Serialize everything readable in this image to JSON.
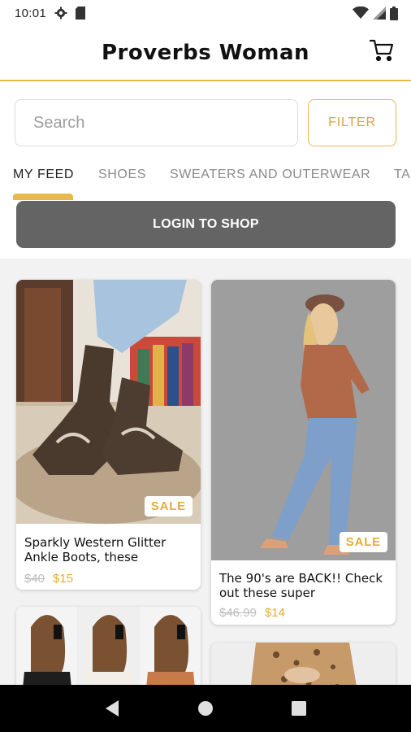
{
  "status_bar": {
    "time": "10:01",
    "icons": [
      "gear-icon",
      "sim-card-icon",
      "wifi-icon",
      "signal-icon",
      "battery-icon"
    ]
  },
  "header": {
    "title": "Proverbs Woman",
    "cart_icon": "cart-icon"
  },
  "search": {
    "placeholder": "Search",
    "filter_label": "FILTER"
  },
  "tabs": [
    {
      "label": "MY FEED",
      "active": true
    },
    {
      "label": "SHOES",
      "active": false
    },
    {
      "label": "SWEATERS AND OUTERWEAR",
      "active": false
    },
    {
      "label": "TA",
      "active": false
    }
  ],
  "login_banner": {
    "label": "LOGIN TO SHOP"
  },
  "products": [
    {
      "title": "Sparkly Western Glitter Ankle  Boots, these",
      "badge": "SALE",
      "old_price": "$40",
      "new_price": "$15",
      "image_icon": "boots-photo"
    },
    {
      "title": "The 90's are BACK!! Check out these super",
      "badge": "SALE",
      "old_price": "$46.99",
      "new_price": "$14",
      "image_icon": "jeans-photo"
    },
    {
      "image_icon": "sweaters-photo"
    },
    {
      "image_icon": "leopard-top-photo"
    }
  ],
  "nav_bar": {
    "icons": [
      "back-icon",
      "home-icon",
      "recents-icon"
    ]
  },
  "colors": {
    "accent": "#e8b94a",
    "banner": "#646464"
  }
}
